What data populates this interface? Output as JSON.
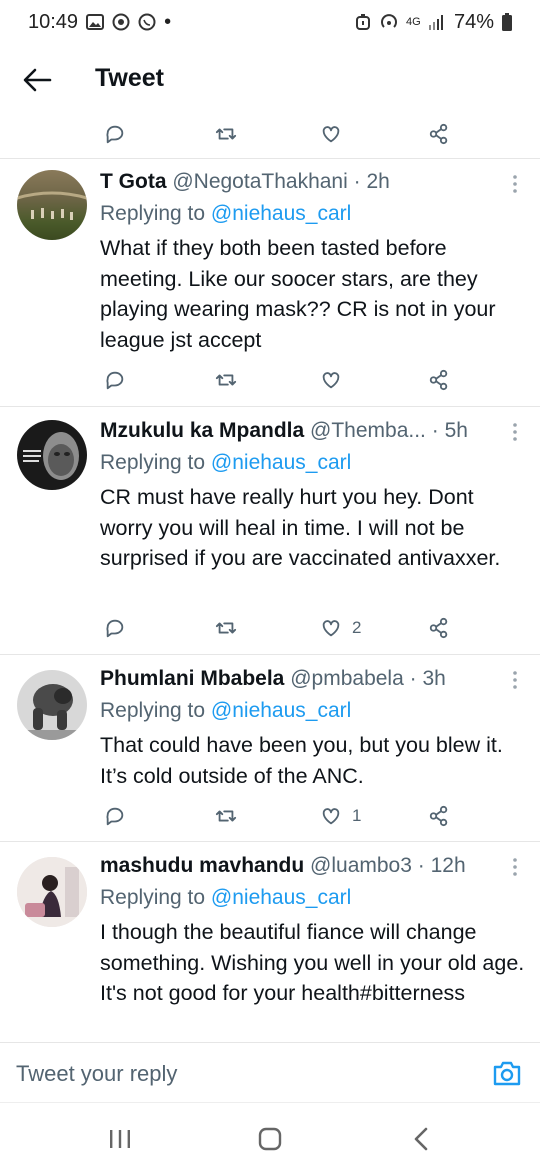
{
  "status": {
    "time": "10:49",
    "battery": "74%",
    "network": "4G"
  },
  "header": {
    "title": "Tweet"
  },
  "compose": {
    "placeholder": "Tweet your reply"
  },
  "tweets": [
    {
      "name": "T Gota",
      "handle": "@NegotaThakhani",
      "time": "2h",
      "replying_prefix": "Replying to",
      "replying_to": "@niehaus_carl",
      "text": "What if they both been tasted before meeting. Like our soocer stars, are they playing wearing mask?? CR is not in your league jst accept",
      "likes": ""
    },
    {
      "name": "Mzukulu ka Mpandla",
      "handle": "@Themba...",
      "time": "5h",
      "replying_prefix": "Replying to",
      "replying_to": "@niehaus_carl",
      "text": "CR must have really hurt you hey. Dont worry you will heal in time. I will not be surprised if you are vaccinated antivaxxer.",
      "likes": "2"
    },
    {
      "name": "Phumlani Mbabela",
      "handle": "@pmbabela",
      "time": "3h",
      "replying_prefix": "Replying to",
      "replying_to": "@niehaus_carl",
      "text": "That could have been you, but you blew it. It’s cold outside of the ANC.",
      "likes": "1"
    },
    {
      "name": "mashudu mavhandu",
      "handle": "@luambo3",
      "time": "12h",
      "replying_prefix": "Replying to",
      "replying_to": "@niehaus_carl",
      "text": "I though the beautiful fiance will change something. Wishing you well in your old age. It's not good for your health#bitterness",
      "likes": ""
    }
  ],
  "colors": {
    "accent": "#1d9bf0",
    "secondary": "#536471",
    "text": "#0f1419",
    "divider": "#e6e6e6"
  },
  "icons": [
    "back-arrow-icon",
    "reply-icon",
    "retweet-icon",
    "like-icon",
    "share-icon",
    "more-icon",
    "camera-icon",
    "recents-icon",
    "home-icon",
    "nav-back-icon"
  ]
}
